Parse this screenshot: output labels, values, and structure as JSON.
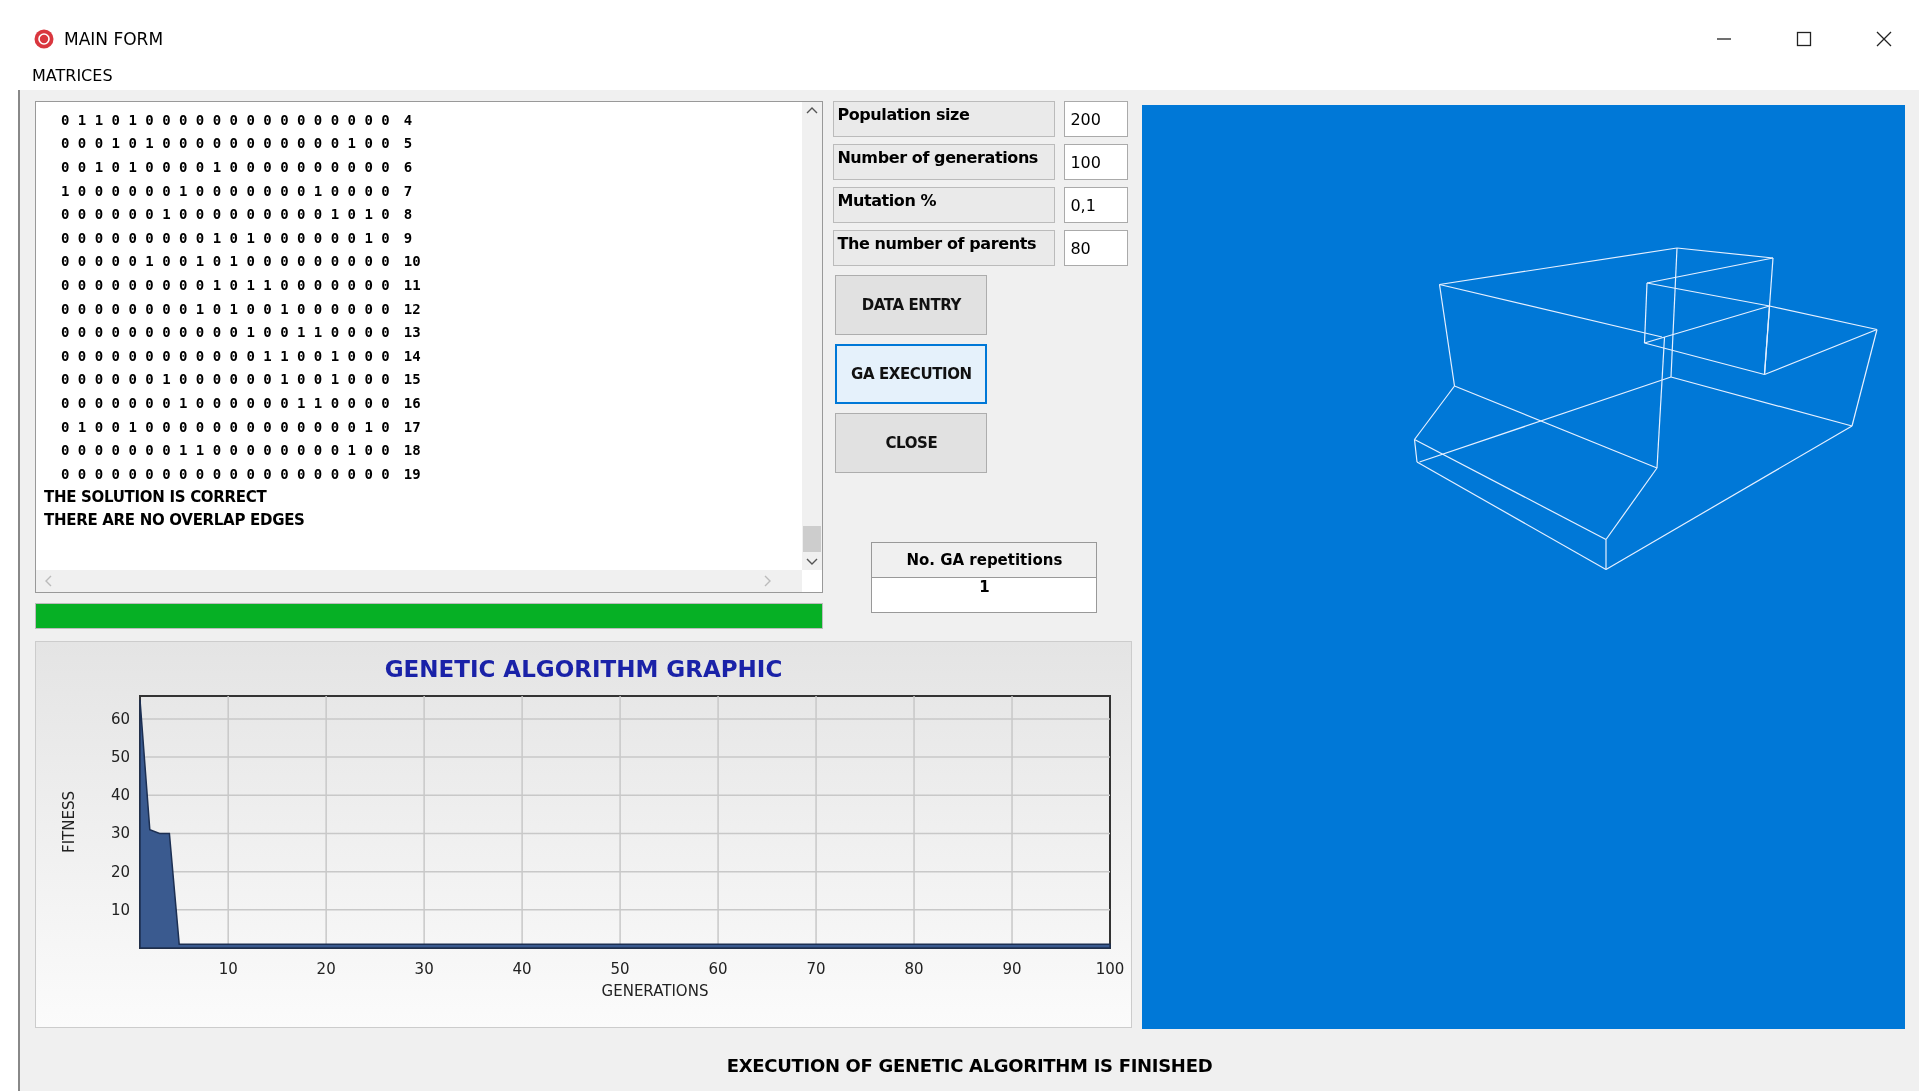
{
  "window": {
    "title": "MAIN FORM"
  },
  "menu": [
    "MATRICES"
  ],
  "matrix_output": {
    "rows": [
      {
        "values": "0 1 1 0 1 0 0 0 0 0 0 0 0 0 0 0 0 0 0 0",
        "index": "4"
      },
      {
        "values": "0 0 0 1 0 1 0 0 0 0 0 0 0 0 0 0 0 1 0 0",
        "index": "5"
      },
      {
        "values": "0 0 1 0 1 0 0 0 0 1 0 0 0 0 0 0 0 0 0 0",
        "index": "6"
      },
      {
        "values": "1 0 0 0 0 0 0 1 0 0 0 0 0 0 0 1 0 0 0 0",
        "index": "7"
      },
      {
        "values": "0 0 0 0 0 0 1 0 0 0 0 0 0 0 0 0 1 0 1 0",
        "index": "8"
      },
      {
        "values": "0 0 0 0 0 0 0 0 0 1 0 1 0 0 0 0 0 0 1 0",
        "index": "9"
      },
      {
        "values": "0 0 0 0 0 1 0 0 1 0 1 0 0 0 0 0 0 0 0 0",
        "index": "10"
      },
      {
        "values": "0 0 0 0 0 0 0 0 0 1 0 1 1 0 0 0 0 0 0 0",
        "index": "11"
      },
      {
        "values": "0 0 0 0 0 0 0 0 1 0 1 0 0 1 0 0 0 0 0 0",
        "index": "12"
      },
      {
        "values": "0 0 0 0 0 0 0 0 0 0 0 1 0 0 1 1 0 0 0 0",
        "index": "13"
      },
      {
        "values": "0 0 0 0 0 0 0 0 0 0 0 0 1 1 0 0 1 0 0 0",
        "index": "14"
      },
      {
        "values": "0 0 0 0 0 0 1 0 0 0 0 0 0 1 0 0 1 0 0 0",
        "index": "15"
      },
      {
        "values": "0 0 0 0 0 0 0 1 0 0 0 0 0 0 1 1 0 0 0 0",
        "index": "16"
      },
      {
        "values": "0 1 0 0 1 0 0 0 0 0 0 0 0 0 0 0 0 0 1 0",
        "index": "17"
      },
      {
        "values": "0 0 0 0 0 0 0 1 1 0 0 0 0 0 0 0 0 1 0 0",
        "index": "18"
      },
      {
        "values": "0 0 0 0 0 0 0 0 0 0 0 0 0 0 0 0 0 0 0 0",
        "index": "19"
      }
    ],
    "messages": [
      "THE SOLUTION IS CORRECT",
      "THERE ARE NO OVERLAP EDGES"
    ]
  },
  "progress": {
    "level": 1
  },
  "parameters": [
    {
      "label": "Population size",
      "value": "200"
    },
    {
      "label": "Number of generations",
      "value": "100"
    },
    {
      "label": "Mutation %",
      "value": "0,1"
    },
    {
      "label": "The number of parents",
      "value": "80"
    }
  ],
  "buttons": [
    {
      "label": "DATA ENTRY",
      "focused": false
    },
    {
      "label": "GA EXECUTION",
      "focused": true
    },
    {
      "label": "CLOSE",
      "focused": false
    }
  ],
  "repetitions": {
    "label": "No. GA repetitions",
    "value": "1"
  },
  "chart": {
    "chart_data": {
      "type": "area",
      "title": "GENETIC ALGORITHM GRAPHIC",
      "xlabel": "GENERATIONS",
      "ylabel": "FITNESS",
      "x": [
        1,
        2,
        3,
        4,
        5,
        100
      ],
      "series": [
        {
          "color": "#3a5a8f",
          "values": [
            65,
            31,
            30,
            30,
            1,
            1
          ]
        }
      ],
      "grid": true,
      "xlim": [
        1,
        100
      ],
      "ylim": [
        0,
        66
      ],
      "xticks": [
        10,
        20,
        30,
        40,
        50,
        60,
        70,
        80,
        90,
        100
      ],
      "yticks": [
        10,
        20,
        30,
        40,
        50,
        60
      ]
    }
  },
  "status_bar": "EXECUTION OF GENETIC ALGORITHM IS FINISHED"
}
